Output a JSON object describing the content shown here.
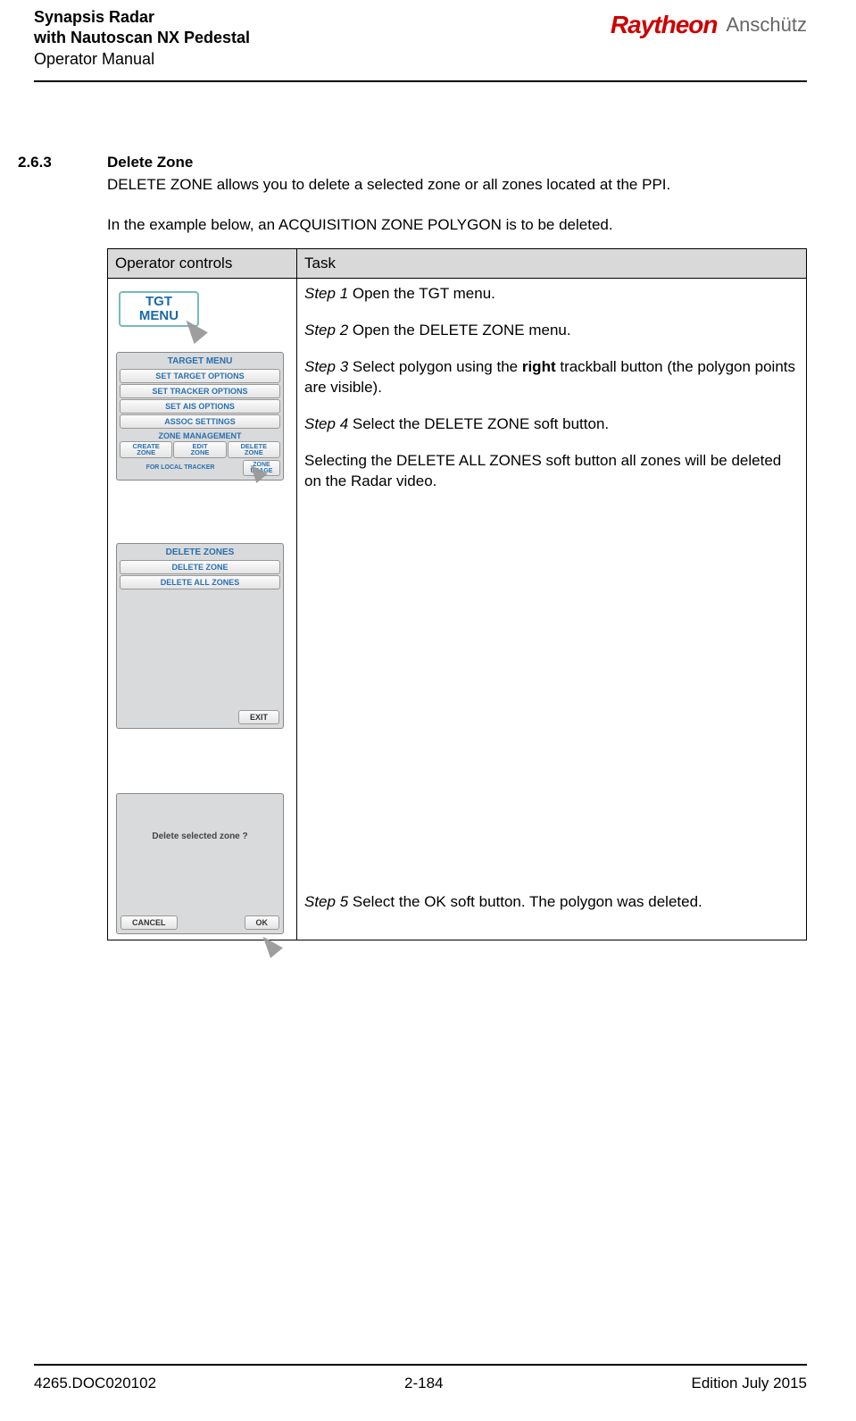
{
  "header": {
    "line1": "Synapsis Radar",
    "line2": "with Nautoscan NX Pedestal",
    "line3": "Operator Manual",
    "logo1": "Raytheon",
    "logo2": "Anschütz"
  },
  "section": {
    "number": "2.6.3",
    "title": "Delete Zone",
    "para1": "DELETE ZONE allows you to delete a selected zone or all zones located at the PPI.",
    "para2": "In the example below, an ACQUISITION ZONE POLYGON is to be deleted."
  },
  "table": {
    "head1": "Operator controls",
    "head2": "Task",
    "step1_label": "Step 1",
    "step1_text": " Open the TGT menu.",
    "step2_label": "Step 2",
    "step2_text": " Open the DELETE ZONE menu.",
    "step3_label": "Step 3",
    "step3_pre": " Select polygon using the ",
    "step3_bold": "right",
    "step3_post": " trackball button (the polygon points are visible).",
    "step4_label": "Step 4",
    "step4_text": " Select the DELETE ZONE soft button.",
    "note": "Selecting the DELETE ALL ZONES soft button all zones will be deleted on the Radar video.",
    "step5_label": "Step 5",
    "step5_text": " Select the OK soft button. The polygon was deleted."
  },
  "mock": {
    "tgt_line1": "TGT",
    "tgt_line2": "MENU",
    "targetmenu_title": "TARGET MENU",
    "btn_set_target": "SET TARGET OPTIONS",
    "btn_set_tracker": "SET TRACKER OPTIONS",
    "btn_set_ais": "SET AIS OPTIONS",
    "btn_assoc": "ASSOC SETTINGS",
    "zone_mgmt": "ZONE MANAGEMENT",
    "create_zone": "CREATE\nZONE",
    "edit_zone": "EDIT\nZONE",
    "delete_zone_btn": "DELETE\nZONE",
    "for_local": "FOR LOCAL TRACKER",
    "zone_usage": "ZONE\nUSAGE",
    "del_title": "DELETE ZONES",
    "del_zone": "DELETE ZONE",
    "del_all": "DELETE ALL ZONES",
    "exit": "EXIT",
    "confirm_q": "Delete selected zone ?",
    "cancel": "CANCEL",
    "ok": "OK"
  },
  "footer": {
    "left": "4265.DOC020102",
    "center": "2-184",
    "right": "Edition July 2015"
  }
}
